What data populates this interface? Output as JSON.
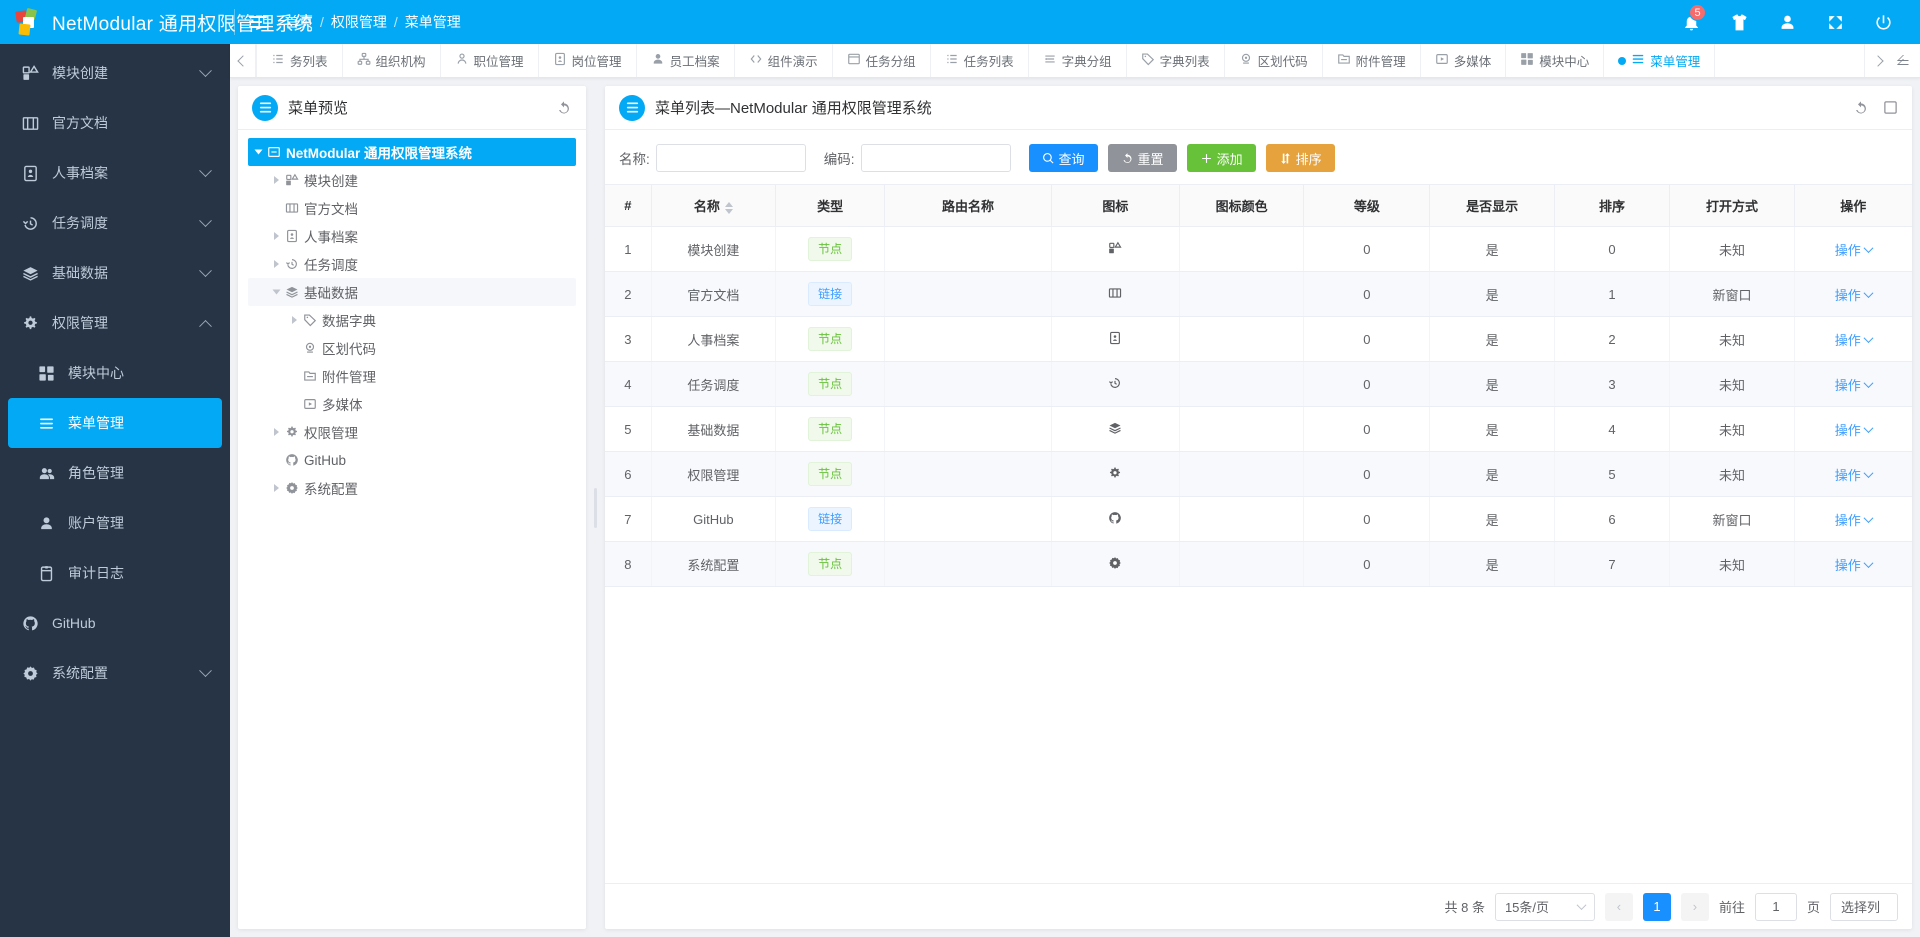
{
  "header": {
    "brand_title": "NetModular 通用权限管理系统",
    "breadcrumb": [
      "首页",
      "权限管理",
      "菜单管理"
    ],
    "separator": "/",
    "notification_count": "5",
    "icons": [
      "bell-icon",
      "shirt-icon",
      "user-icon",
      "fullscreen-icon",
      "power-icon"
    ],
    "accent_color": "#03a9f4"
  },
  "sidebar": {
    "items": [
      {
        "label": "模块创建",
        "icon": "blocks-icon",
        "expandable": true,
        "expanded": false,
        "active": false
      },
      {
        "label": "官方文档",
        "icon": "book-icon",
        "expandable": false,
        "expanded": false,
        "active": false
      },
      {
        "label": "人事档案",
        "icon": "id-card-icon",
        "expandable": true,
        "expanded": false,
        "active": false
      },
      {
        "label": "任务调度",
        "icon": "clock-history-icon",
        "expandable": true,
        "expanded": false,
        "active": false
      },
      {
        "label": "基础数据",
        "icon": "layers-icon",
        "expandable": true,
        "expanded": false,
        "active": false
      },
      {
        "label": "权限管理",
        "icon": "gear-cog-icon",
        "expandable": true,
        "expanded": true,
        "active": false
      }
    ],
    "sub_items": [
      {
        "label": "模块中心",
        "icon": "grid-blocks-icon",
        "active": false
      },
      {
        "label": "菜单管理",
        "icon": "menu-lines-icon",
        "active": true
      },
      {
        "label": "角色管理",
        "icon": "users-icon",
        "active": false
      },
      {
        "label": "账户管理",
        "icon": "user-icon",
        "active": false
      },
      {
        "label": "审计日志",
        "icon": "clipboard-icon",
        "active": false
      }
    ],
    "bottom_items": [
      {
        "label": "GitHub",
        "icon": "github-icon",
        "expandable": false
      },
      {
        "label": "系统配置",
        "icon": "gear-icon",
        "expandable": true
      }
    ]
  },
  "tabbar": {
    "tabs": [
      {
        "label": "务列表",
        "icon": "list-icon",
        "active": false,
        "truncated": true
      },
      {
        "label": "组织机构",
        "icon": "org-tree-icon",
        "active": false
      },
      {
        "label": "职位管理",
        "icon": "person-badge-icon",
        "active": false
      },
      {
        "label": "岗位管理",
        "icon": "id-card-icon",
        "active": false
      },
      {
        "label": "员工档案",
        "icon": "user-icon",
        "active": false
      },
      {
        "label": "组件演示",
        "icon": "code-icon",
        "active": false
      },
      {
        "label": "任务分组",
        "icon": "window-icon",
        "active": false
      },
      {
        "label": "任务列表",
        "icon": "list-icon",
        "active": false
      },
      {
        "label": "字典分组",
        "icon": "sitemap-icon",
        "active": false
      },
      {
        "label": "字典列表",
        "icon": "tag-icon",
        "active": false
      },
      {
        "label": "区划代码",
        "icon": "map-pin-icon",
        "active": false
      },
      {
        "label": "附件管理",
        "icon": "folder-icon",
        "active": false
      },
      {
        "label": "多媒体",
        "icon": "play-box-icon",
        "active": false
      },
      {
        "label": "模块中心",
        "icon": "grid-blocks-icon",
        "active": false
      },
      {
        "label": "菜单管理",
        "icon": "menu-lines-icon",
        "active": true
      }
    ]
  },
  "tree_panel": {
    "title": "菜单预览",
    "refresh_icon": "refresh-icon",
    "nodes": [
      {
        "label": "NetModular 通用权限管理系统",
        "level": 0,
        "icon": "minus-square-icon",
        "toggle": "open",
        "selected": true
      },
      {
        "label": "模块创建",
        "level": 1,
        "icon": "blocks-icon",
        "toggle": "closed",
        "selected": false
      },
      {
        "label": "官方文档",
        "level": 1,
        "icon": "book-icon",
        "toggle": "none",
        "selected": false
      },
      {
        "label": "人事档案",
        "level": 1,
        "icon": "id-card-icon",
        "toggle": "closed",
        "selected": false
      },
      {
        "label": "任务调度",
        "level": 1,
        "icon": "clock-history-icon",
        "toggle": "closed",
        "selected": false
      },
      {
        "label": "基础数据",
        "level": 1,
        "icon": "layers-icon",
        "toggle": "open",
        "selected": false,
        "highlight": true
      },
      {
        "label": "数据字典",
        "level": 2,
        "icon": "tag-icon",
        "toggle": "closed",
        "selected": false
      },
      {
        "label": "区划代码",
        "level": 2,
        "icon": "map-pin-icon",
        "toggle": "none",
        "selected": false
      },
      {
        "label": "附件管理",
        "level": 2,
        "icon": "folder-icon",
        "toggle": "none",
        "selected": false
      },
      {
        "label": "多媒体",
        "level": 2,
        "icon": "play-box-icon",
        "toggle": "none",
        "selected": false
      },
      {
        "label": "权限管理",
        "level": 1,
        "icon": "gear-cog-icon",
        "toggle": "closed",
        "selected": false
      },
      {
        "label": "GitHub",
        "level": 1,
        "icon": "github-icon",
        "toggle": "none",
        "selected": false
      },
      {
        "label": "系统配置",
        "level": 1,
        "icon": "gear-icon",
        "toggle": "closed",
        "selected": false
      }
    ]
  },
  "list_panel": {
    "title": "菜单列表—NetModular 通用权限管理系统",
    "header_icons": [
      "refresh-icon",
      "maximize-icon"
    ],
    "toolbar": {
      "name_label": "名称:",
      "name_value": "",
      "name_placeholder": "",
      "code_label": "编码:",
      "code_value": "",
      "code_placeholder": "",
      "search_label": "查询",
      "reset_label": "重置",
      "add_label": "添加",
      "sort_label": "排序"
    },
    "columns": [
      "#",
      "名称",
      "类型",
      "路由名称",
      "图标",
      "图标颜色",
      "等级",
      "是否显示",
      "排序",
      "打开方式",
      "操作"
    ],
    "sortable_column": "名称",
    "rows": [
      {
        "index": "1",
        "name": "模块创建",
        "type": "节点",
        "type_kind": "node",
        "route": "",
        "icon": "blocks-icon",
        "icon_color": "",
        "level": "0",
        "visible": "是",
        "sort": "0",
        "open_mode": "未知",
        "action": "操作"
      },
      {
        "index": "2",
        "name": "官方文档",
        "type": "链接",
        "type_kind": "link",
        "route": "",
        "icon": "book-icon",
        "icon_color": "",
        "level": "0",
        "visible": "是",
        "sort": "1",
        "open_mode": "新窗口",
        "action": "操作"
      },
      {
        "index": "3",
        "name": "人事档案",
        "type": "节点",
        "type_kind": "node",
        "route": "",
        "icon": "id-card-icon",
        "icon_color": "",
        "level": "0",
        "visible": "是",
        "sort": "2",
        "open_mode": "未知",
        "action": "操作"
      },
      {
        "index": "4",
        "name": "任务调度",
        "type": "节点",
        "type_kind": "node",
        "route": "",
        "icon": "clock-history-icon",
        "icon_color": "",
        "level": "0",
        "visible": "是",
        "sort": "3",
        "open_mode": "未知",
        "action": "操作"
      },
      {
        "index": "5",
        "name": "基础数据",
        "type": "节点",
        "type_kind": "node",
        "route": "",
        "icon": "layers-icon",
        "icon_color": "",
        "level": "0",
        "visible": "是",
        "sort": "4",
        "open_mode": "未知",
        "action": "操作"
      },
      {
        "index": "6",
        "name": "权限管理",
        "type": "节点",
        "type_kind": "node",
        "route": "",
        "icon": "gear-cog-icon",
        "icon_color": "",
        "level": "0",
        "visible": "是",
        "sort": "5",
        "open_mode": "未知",
        "action": "操作"
      },
      {
        "index": "7",
        "name": "GitHub",
        "type": "链接",
        "type_kind": "link",
        "route": "",
        "icon": "github-icon",
        "icon_color": "",
        "level": "0",
        "visible": "是",
        "sort": "6",
        "open_mode": "新窗口",
        "action": "操作"
      },
      {
        "index": "8",
        "name": "系统配置",
        "type": "节点",
        "type_kind": "node",
        "route": "",
        "icon": "gear-icon",
        "icon_color": "",
        "level": "0",
        "visible": "是",
        "sort": "7",
        "open_mode": "未知",
        "action": "操作"
      }
    ],
    "pagination": {
      "total_text": "共 8 条",
      "page_size": "15条/页",
      "prev": "‹",
      "next": "›",
      "current_page": "1",
      "goto_prefix": "前往",
      "goto_value": "1",
      "goto_suffix": "页",
      "column_select": "选择列"
    }
  }
}
